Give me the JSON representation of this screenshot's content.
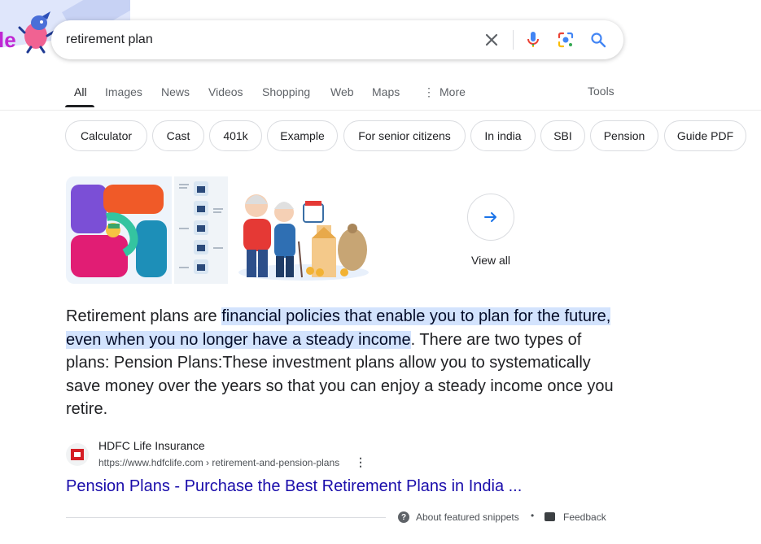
{
  "search": {
    "query": "retirement plan",
    "clear_icon": "close-icon",
    "voice_icon": "microphone-icon",
    "lens_icon": "google-lens-icon",
    "submit_icon": "search-icon"
  },
  "doodle": {
    "letter": "le"
  },
  "tabs": [
    {
      "label": "All"
    },
    {
      "label": "Images"
    },
    {
      "label": "News"
    },
    {
      "label": "Videos"
    },
    {
      "label": "Shopping"
    },
    {
      "label": "Web"
    },
    {
      "label": "Maps"
    },
    {
      "label": "More"
    }
  ],
  "tools_label": "Tools",
  "chips": [
    "Calculator",
    "Cast",
    "401k",
    "Example",
    "For senior citizens",
    "In india",
    "SBI",
    "Pension",
    "Guide PDF"
  ],
  "images": {
    "view_all_label": "View all"
  },
  "snippet": {
    "pre": "Retirement plans are ",
    "highlight": "financial policies that enable you to plan for the future, even when you no longer have a steady income",
    "post": ". There are two types of plans: Pension Plans:These investment plans allow you to systematically save money over the years so that you can enjoy a steady income once you retire."
  },
  "source": {
    "name": "HDFC Life Insurance",
    "url": "https://www.hdfclife.com › retirement-and-pension-plans",
    "menu": "⋮",
    "title": "Pension Plans - Purchase the Best Retirement Plans in India ..."
  },
  "footer": {
    "about": "About featured snippets",
    "separator": "•",
    "feedback": "Feedback"
  },
  "colors": {
    "link": "#1a0dab",
    "highlight": "#d3e3fd",
    "accent_blue": "#4285f4",
    "brand_red": "#d51f26"
  }
}
